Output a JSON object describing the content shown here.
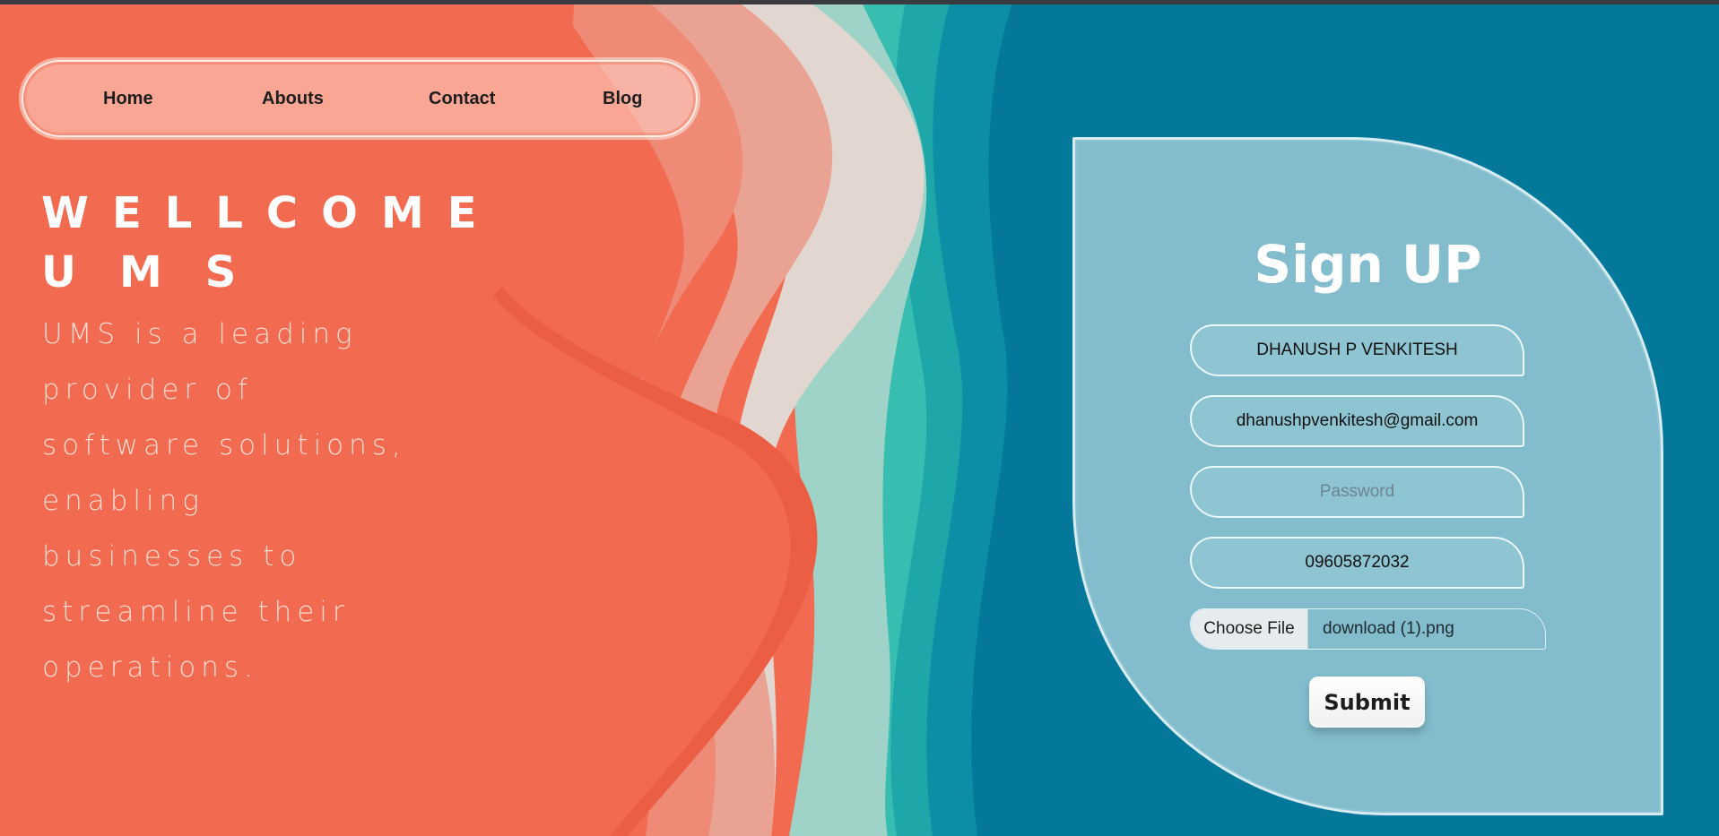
{
  "nav": {
    "items": [
      {
        "label": "Home"
      },
      {
        "label": "Abouts"
      },
      {
        "label": "Contact"
      },
      {
        "label": "Blog"
      }
    ]
  },
  "hero": {
    "title_line1": "WELLCOME",
    "title_line2": "UMS",
    "description_lines": [
      "UMS is a leading",
      "provider of",
      "software solutions,",
      "enabling",
      "businesses to",
      "streamline their",
      "operations."
    ]
  },
  "signup": {
    "title": "Sign UP",
    "name_value": "DHANUSH P VENKITESH",
    "email_value": "dhanushpvenkitesh@gmail.com",
    "password_placeholder": "Password",
    "phone_value": "09605872032",
    "file_button_label": "Choose File",
    "file_name": "download (1).png",
    "submit_label": "Submit"
  },
  "colors": {
    "coral": "#f26a4f",
    "teal_dark": "#03789b",
    "teal_mid": "#2fb8ad",
    "card_bg": "#b4d7e1"
  }
}
